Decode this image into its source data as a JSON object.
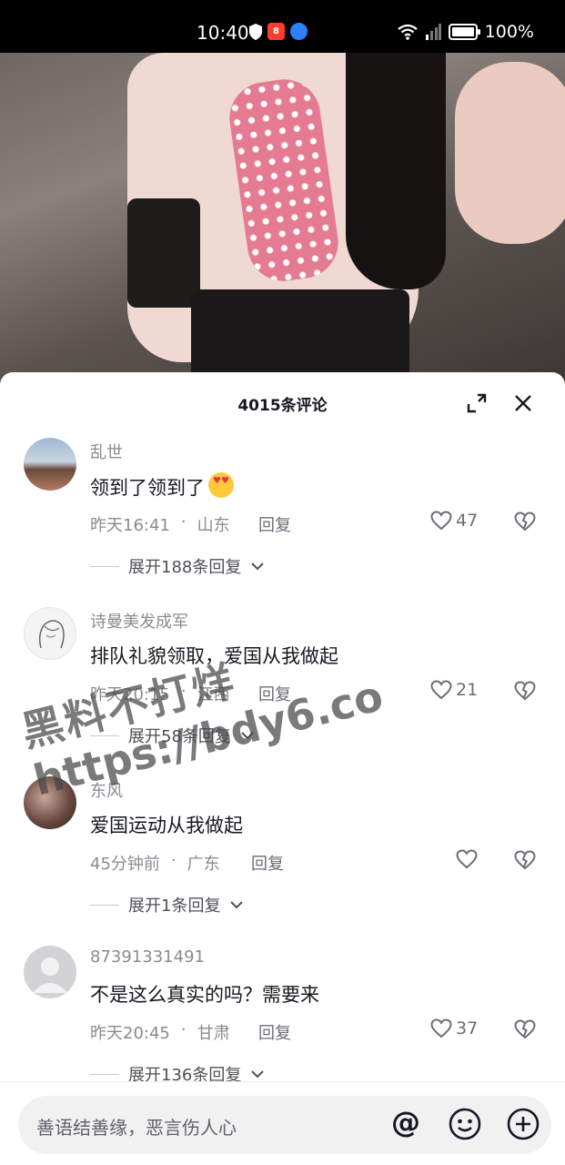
{
  "status_bar": {
    "time": "10:40",
    "battery": "100%",
    "battery_level": 1.0,
    "app_badge": "8"
  },
  "comments_panel": {
    "title": "4015条评论"
  },
  "comments": [
    {
      "user": "乱世",
      "text": "领到了领到了",
      "emoji": "heart-eyes-emoji",
      "time": "昨天16:41",
      "location": "山东",
      "reply_label": "回复",
      "likes": "47",
      "expand_label": "展开188条回复"
    },
    {
      "user": "诗曼美发成军",
      "text": "排队礼貌领取，爱国从我做起",
      "time": "昨天20:15",
      "location": "江西",
      "reply_label": "回复",
      "likes": "21",
      "expand_label": "展开58条回复"
    },
    {
      "user": "东风",
      "text": "爱国运动从我做起",
      "time": "45分钟前",
      "location": "广东",
      "reply_label": "回复",
      "likes": "",
      "expand_label": "展开1条回复"
    },
    {
      "user": "87391331491",
      "text": "不是这么真实的吗？需要来",
      "time": "昨天20:45",
      "location": "甘肃",
      "reply_label": "回复",
      "likes": "37",
      "expand_label": "展开136条回复"
    }
  ],
  "watermark": {
    "line1": "黑料不打烊",
    "line2": "https://bdy6.co"
  },
  "input_bar": {
    "placeholder": "善语结善缘，恶言伤人心"
  },
  "colors": {
    "text_primary": "#161823",
    "text_secondary": "#8a8b91",
    "status_bar_bg": "#000000"
  }
}
